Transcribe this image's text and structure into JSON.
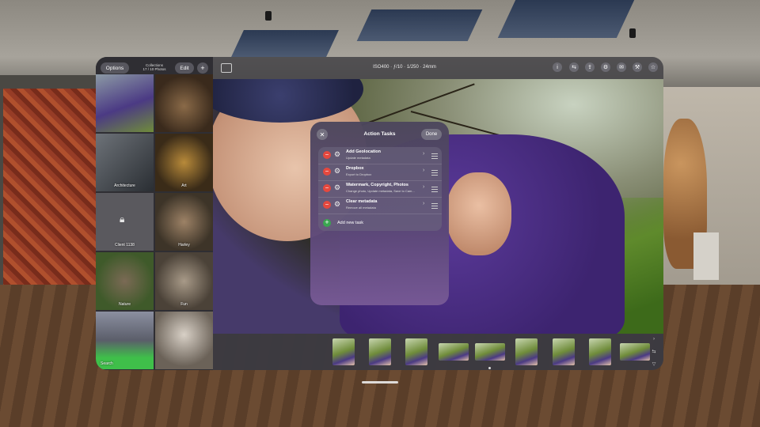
{
  "sidebar": {
    "options_label": "Options",
    "collection_title": "Collections",
    "collection_subtitle": "17 / 10 Photos",
    "edit_label": "Edit",
    "add_label": "+",
    "tiles": [
      {
        "label": ""
      },
      {
        "label": ""
      },
      {
        "label": "Architecture"
      },
      {
        "label": "Art"
      },
      {
        "label": "Client 1138"
      },
      {
        "label": "Harley"
      },
      {
        "label": "Nature"
      },
      {
        "label": "Fun"
      },
      {
        "label": "Search"
      },
      {
        "label": ""
      }
    ]
  },
  "toolbar": {
    "exif": "ISO400 · ƒ/10 · 1/250 · 24mm",
    "icons": [
      "info-icon",
      "adjust-icon",
      "share-photo-icon",
      "settings-icon",
      "mail-icon",
      "wrench-icon",
      "star-icon"
    ]
  },
  "modal": {
    "title": "Action Tasks",
    "close_label": "✕",
    "done_label": "Done",
    "tasks": [
      {
        "name": "Add Geolocation",
        "subtitle": "Update metadata"
      },
      {
        "name": "Dropbox",
        "subtitle": "Export to Dropbox"
      },
      {
        "name": "Watermark, Copyright, Photos",
        "subtitle": "Change photo, Update metadata, Save to Cam..."
      },
      {
        "name": "Clear metadata",
        "subtitle": "Remove all metadata"
      }
    ],
    "add_label": "Add new task"
  },
  "filmstrip": {
    "count": 9
  },
  "colors": {
    "remove": "#e5483e",
    "add": "#3aa64f",
    "sweater": "#5b3a9a"
  }
}
